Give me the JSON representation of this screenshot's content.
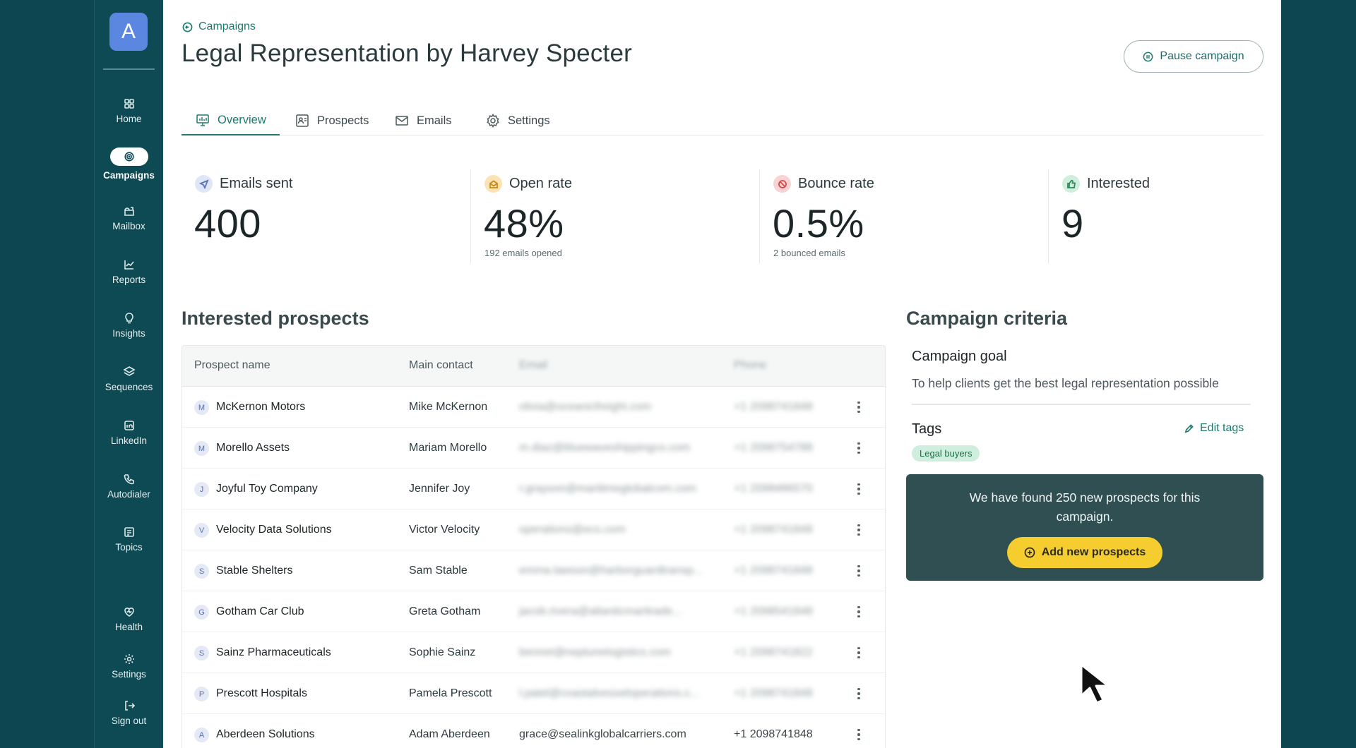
{
  "sidebar": {
    "logo": "A",
    "items": [
      {
        "label": "Home",
        "icon": "grid-icon"
      },
      {
        "label": "Campaigns",
        "icon": "target-icon"
      },
      {
        "label": "Mailbox",
        "icon": "mailbox-icon"
      },
      {
        "label": "Reports",
        "icon": "chart-icon"
      },
      {
        "label": "Insights",
        "icon": "lightbulb-icon"
      },
      {
        "label": "Sequences",
        "icon": "layers-icon"
      },
      {
        "label": "LinkedIn",
        "icon": "linkedin-icon"
      },
      {
        "label": "Autodialer",
        "icon": "phone-icon"
      },
      {
        "label": "Topics",
        "icon": "topics-icon"
      },
      {
        "label": "Health",
        "icon": "heart-icon"
      },
      {
        "label": "Settings",
        "icon": "gear-icon"
      },
      {
        "label": "Sign out",
        "icon": "sign-out-icon"
      }
    ],
    "active": "Campaigns"
  },
  "header": {
    "breadcrumb": "Campaigns",
    "title": "Legal Representation by Harvey Specter",
    "pause_label": "Pause campaign"
  },
  "tabs": [
    {
      "label": "Overview",
      "active": true
    },
    {
      "label": "Prospects",
      "active": false
    },
    {
      "label": "Emails",
      "active": false
    },
    {
      "label": "Settings",
      "active": false
    }
  ],
  "stats": [
    {
      "label": "Emails sent",
      "value": "400",
      "sub": "",
      "color": "#dfe6f7"
    },
    {
      "label": "Open rate",
      "value": "48%",
      "sub": "192 emails opened",
      "color": "#fbe3b5"
    },
    {
      "label": "Bounce rate",
      "value": "0.5%",
      "sub": "2 bounced emails",
      "color": "#f8d3d3"
    },
    {
      "label": "Interested",
      "value": "9",
      "sub": "",
      "color": "#cfeedd"
    }
  ],
  "prospects": {
    "title": "Interested prospects",
    "columns": [
      "Prospect name",
      "Main contact",
      "Email",
      "Phone"
    ],
    "rows": [
      {
        "initial": "M",
        "name": "McKernon Motors",
        "contact": "Mike McKernon",
        "email": "olivia@oceanicfreight.com",
        "phone": "+1 2098741848"
      },
      {
        "initial": "M",
        "name": "Morello Assets",
        "contact": "Mariam Morello",
        "email": "m.diaz@bluewaveshippingco.com",
        "phone": "+1 2098754788"
      },
      {
        "initial": "J",
        "name": "Joyful Toy Company",
        "contact": "Jennifer Joy",
        "email": "r.grayson@maritimeglobalcom.com",
        "phone": "+1 2098486570"
      },
      {
        "initial": "V",
        "name": "Velocity Data Solutions",
        "contact": "Victor Velocity",
        "email": "operations@ecs.com",
        "phone": "+1 2098741848"
      },
      {
        "initial": "S",
        "name": "Stable Shelters",
        "contact": "Sam Stable",
        "email": "emma.lawson@harborguardtransp...",
        "phone": "+1 2098741848"
      },
      {
        "initial": "G",
        "name": "Gotham Car Club",
        "contact": "Greta Gotham",
        "email": "jacob.rivera@atlanticmaritrade...",
        "phone": "+1 2098541848"
      },
      {
        "initial": "S",
        "name": "Sainz Pharmaceuticals",
        "contact": "Sophie Sainz",
        "email": "bennet@neptunelogistics.com",
        "phone": "+1 2098741822"
      },
      {
        "initial": "P",
        "name": "Prescott Hospitals",
        "contact": "Pamela Prescott",
        "email": "l.patel@coastalvesseloperations.c...",
        "phone": "+1 2098741848"
      },
      {
        "initial": "A",
        "name": "Aberdeen Solutions",
        "contact": "Adam Aberdeen",
        "email": "grace@sealinkglobalcarriers.com",
        "phone": "+1 2098741848"
      }
    ]
  },
  "criteria": {
    "title": "Campaign criteria",
    "goal_label": "Campaign goal",
    "goal_text": "To help clients get the best legal representation possible",
    "tags_label": "Tags",
    "edit_tags_label": "Edit tags",
    "tags": [
      "Legal buyers"
    ]
  },
  "promo": {
    "message": "We have found 250 new prospects for this campaign.",
    "cta_label": "Add new prospects"
  }
}
